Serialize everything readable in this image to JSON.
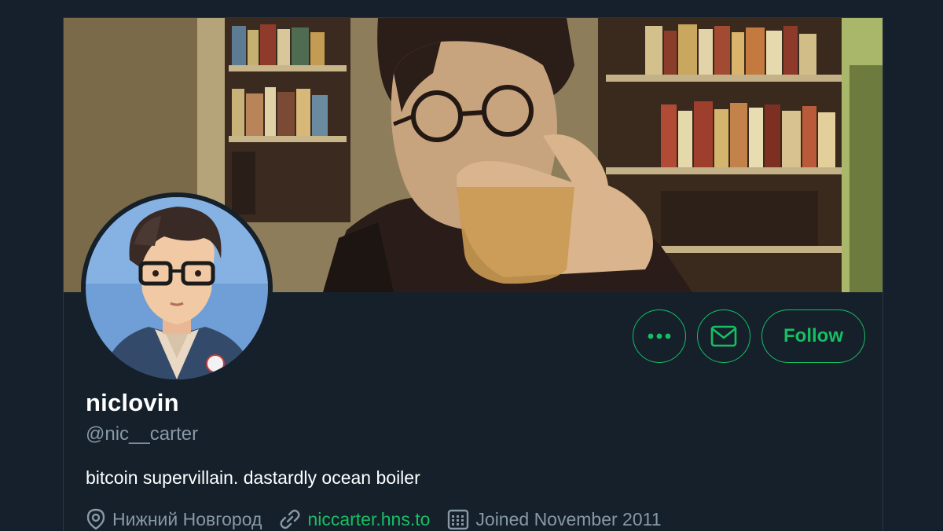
{
  "profile": {
    "display_name": "niclovin",
    "handle": "@nic__carter",
    "bio": "bitcoin supervillain. dastardly ocean boiler",
    "location": "Нижний Новгород",
    "website": "niccarter.hns.to",
    "joined": "Joined November 2011"
  },
  "actions": {
    "follow_label": "Follow"
  },
  "icons": {
    "more": "more-dots-icon",
    "message": "envelope-icon",
    "location": "location-pin-icon",
    "link": "link-icon",
    "calendar": "calendar-icon"
  },
  "colors": {
    "background": "#15202b",
    "accent": "#17bf63",
    "secondary_text": "#8899a6",
    "primary_text": "#ffffff"
  }
}
